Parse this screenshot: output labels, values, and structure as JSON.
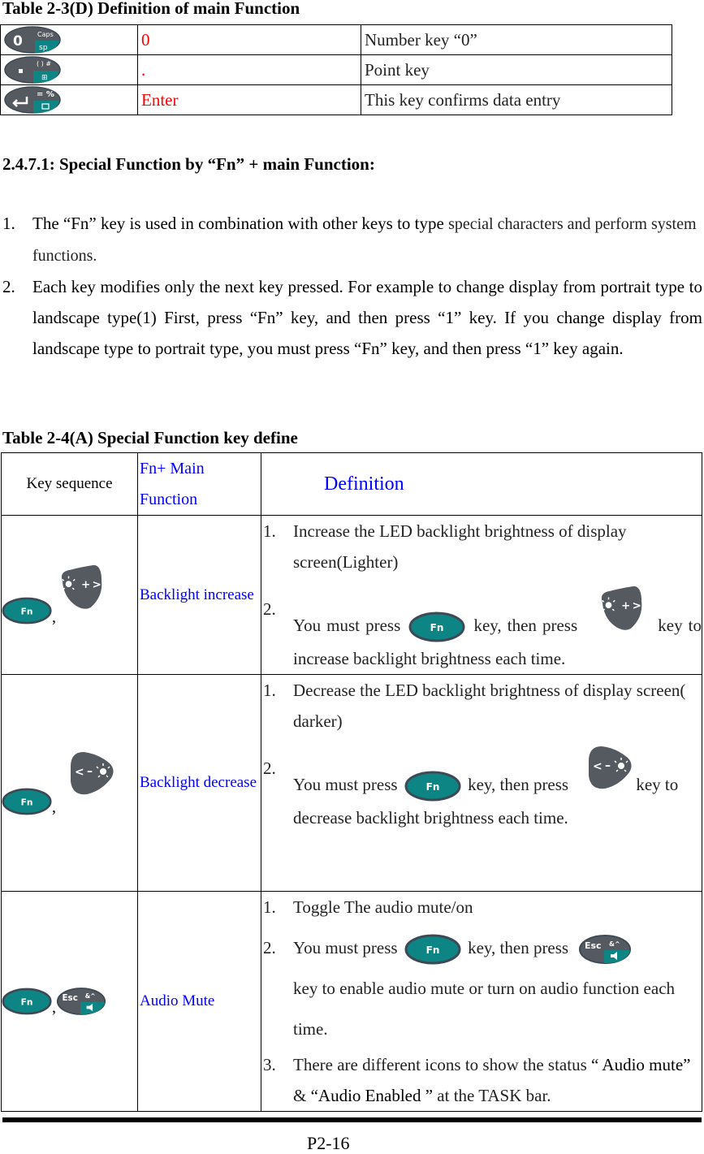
{
  "table_d": {
    "caption": "Table 2-3(D) Definition of main Function",
    "rows": [
      {
        "icon": "zero-caps-sp-key-icon",
        "key": "0",
        "description": "Number key  “0”"
      },
      {
        "icon": "point-start-key-icon",
        "key": ".",
        "description": "Point key"
      },
      {
        "icon": "enter-key-icon",
        "key": "Enter",
        "description": "This key confirms data entry"
      }
    ]
  },
  "section": {
    "heading": "2.4.7.1: Special Function by “Fn” + main Function:",
    "items": [
      {
        "num": "1.",
        "text": "The “Fn” key is used in combination with other keys to type ",
        "text_thin": "special characters and perform system functions."
      },
      {
        "num": "2.",
        "text": "Each key modifies only the next key pressed. For example to change display from portrait type to landscape type(1) First, press “Fn” key, and then press “1” key. If you change display from landscape type to portrait type, you must press “Fn” key, and then press “1” key again."
      }
    ]
  },
  "table_a": {
    "caption": "Table 2-4(A) Special Function key define",
    "headers": {
      "key_sequence": "Key sequence",
      "fn_main": "Fn+ Main Function",
      "definition": "Definition"
    },
    "rows": [
      {
        "function": "Backlight increase",
        "sequence_sep": ",",
        "definition": [
          {
            "num": "1.",
            "text": "Increase the LED backlight brightness of display screen(Lighter)"
          },
          {
            "num": "2.",
            "pre": "You must press",
            "mid": "key, then press",
            "post": "key to increase backlight brightness each time."
          }
        ]
      },
      {
        "function": "Backlight decrease",
        "sequence_sep": ",",
        "definition": [
          {
            "num": "1.",
            "text": "Decrease the LED backlight brightness of display screen( darker)"
          },
          {
            "num": "2.",
            "pre": "You must press",
            "mid": "key, then press",
            "post": "key to decrease backlight brightness each time."
          }
        ]
      },
      {
        "function": "Audio Mute",
        "sequence_sep": ",",
        "definition": [
          {
            "num": "1.",
            "text": "Toggle The audio mute/on"
          },
          {
            "num": "2.",
            "pre": "You must press",
            "mid": "key, then press",
            "post": "key to enable audio mute or turn on audio function each time."
          },
          {
            "num": "3.",
            "pre": "There are different icons to show the status ",
            "q1": "“ Audio mute”",
            "amp": " & ",
            "q2": "“Audio Enabled ”",
            "post": " at the TASK bar."
          }
        ]
      }
    ]
  },
  "footer": {
    "page_number": "P2-16"
  },
  "colors": {
    "key_teal": "#0e8585",
    "key_gray": "#555a60",
    "red": "#ff0000",
    "blue": "#0000ff"
  }
}
